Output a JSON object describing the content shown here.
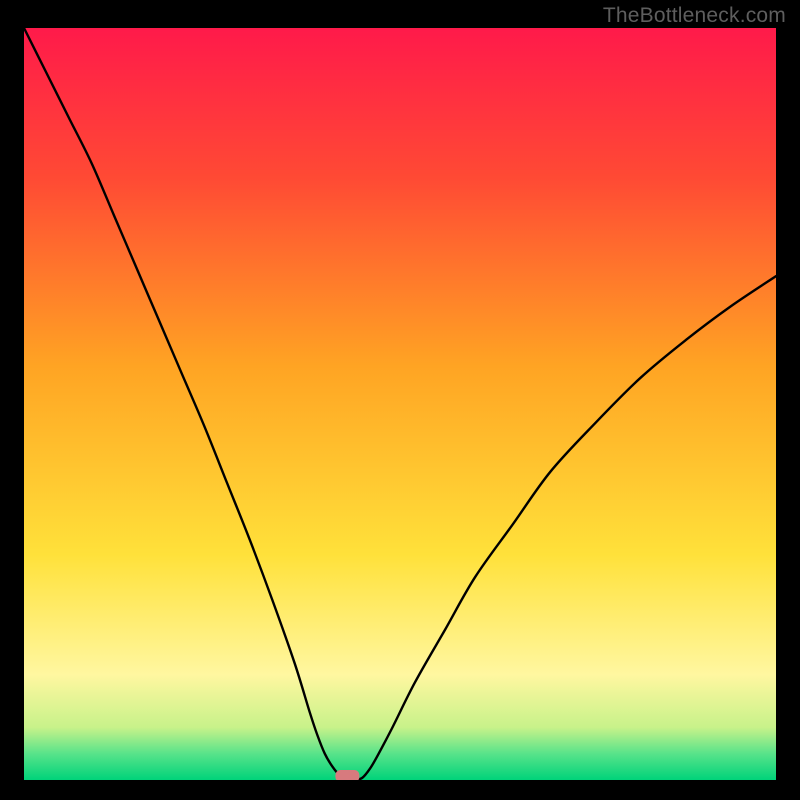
{
  "watermark": "TheBottleneck.com",
  "chart_data": {
    "type": "line",
    "title": "",
    "xlabel": "",
    "ylabel": "",
    "xlim": [
      0,
      100
    ],
    "ylim": [
      0,
      100
    ],
    "gradient_background": {
      "stops": [
        {
          "offset": 0.0,
          "color": "#ff1a4a"
        },
        {
          "offset": 0.2,
          "color": "#ff4a34"
        },
        {
          "offset": 0.45,
          "color": "#ffa423"
        },
        {
          "offset": 0.7,
          "color": "#ffe13a"
        },
        {
          "offset": 0.86,
          "color": "#fff7a0"
        },
        {
          "offset": 0.93,
          "color": "#c8f28a"
        },
        {
          "offset": 0.965,
          "color": "#58e38a"
        },
        {
          "offset": 1.0,
          "color": "#00d37a"
        }
      ]
    },
    "marker": {
      "x": 43,
      "y": 0,
      "color": "#d77a7e",
      "shape": "rounded-rect"
    },
    "series": [
      {
        "name": "bottleneck-curve",
        "color": "#000000",
        "stroke_width": 2.4,
        "x": [
          0,
          3,
          6,
          9,
          12,
          15,
          18,
          21,
          24,
          27,
          30,
          33,
          36,
          38,
          39,
          40,
          41,
          42,
          43,
          44,
          45,
          46,
          47,
          49,
          52,
          56,
          60,
          65,
          70,
          76,
          82,
          88,
          94,
          100
        ],
        "y": [
          100,
          94,
          88,
          82,
          75,
          68,
          61,
          54,
          47,
          39.5,
          32,
          24,
          15.5,
          9,
          6,
          3.5,
          1.8,
          0.6,
          0,
          0,
          0.3,
          1.5,
          3.2,
          7,
          13,
          20,
          27,
          34,
          41,
          47.5,
          53.5,
          58.5,
          63,
          67
        ]
      }
    ]
  }
}
